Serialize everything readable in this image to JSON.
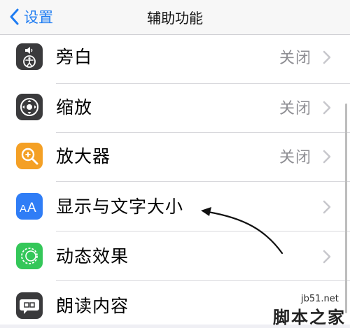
{
  "nav": {
    "back_label": "设置",
    "title": "辅助功能"
  },
  "rows": [
    {
      "label": "旁白",
      "value": "关闭",
      "icon": "voiceover-icon",
      "icon_color": "#3a3a3c"
    },
    {
      "label": "缩放",
      "value": "关闭",
      "icon": "zoom-icon",
      "icon_color": "#3a3a3c"
    },
    {
      "label": "放大器",
      "value": "关闭",
      "icon": "magnifier-icon",
      "icon_color": "#f4a025"
    },
    {
      "label": "显示与文字大小",
      "value": "",
      "icon": "text-size-icon",
      "icon_color": "#2f7df6"
    },
    {
      "label": "动态效果",
      "value": "",
      "icon": "motion-icon",
      "icon_color": "#34c759"
    },
    {
      "label": "朗读内容",
      "value": "",
      "icon": "spoken-content-icon",
      "icon_color": "#3a3a3c"
    }
  ],
  "watermark": {
    "site": "jb51.net",
    "brand": "脚本之家"
  },
  "colors": {
    "accent": "#1e7cf2",
    "chevron": "#c7c7cc"
  }
}
